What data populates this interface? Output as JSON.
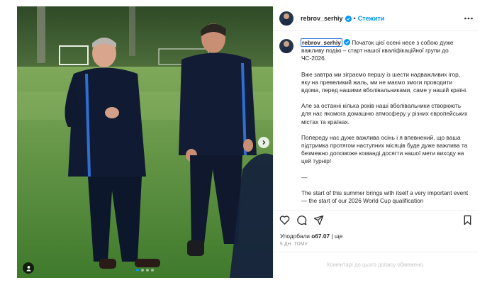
{
  "post": {
    "username": "rebrov_serhiy",
    "follow_label": "Стежити",
    "separator": "•",
    "caption": [
      "Початок цієї осені несе з собою дуже важливу подію – старт нашої кваліфікаційної групи до ЧС-2026.",
      "Вже завтра ми зіграємо першу із шести надважливих ігор, яку на превеликий жаль, ми не маємо змоги проводити вдома, перед нашими вболівальниками, саме у нашій країні.",
      "Але за останні кілька років наші вболівальники створюють для нас якомога домашню атмосферу у різних європейських містах та країнах.",
      "Попереду нас дуже важлива осінь і я впевнений, що ваша підтримка протягом наступних місяців буде дуже важлива та безмежно допоможе команді досягти нашої мети виходу на цей турнір!",
      "—",
      "The start of this summer brings with itself a very important event — the start of our 2026 World Cup qualification"
    ],
    "likes_prefix": "Уподобали ",
    "likes_count": "o67.07",
    "likes_suffix": " | ще",
    "timestamp": "5 ДН. ТОМУ",
    "comments_disabled": "Коментарі до цього допису обмежено.",
    "carousel": {
      "total": 4,
      "active_index": 0
    }
  },
  "colors": {
    "accent": "#0095f6",
    "text": "#262626",
    "muted": "#8e8e8e",
    "verified": "#0095f6"
  },
  "icons": {
    "verified": "verified-badge-icon",
    "more": "more-options-icon",
    "like": "heart-icon",
    "comment": "comment-bubble-icon",
    "share": "paper-plane-icon",
    "save": "bookmark-icon",
    "next": "chevron-right-icon",
    "tag": "user-tag-icon"
  }
}
